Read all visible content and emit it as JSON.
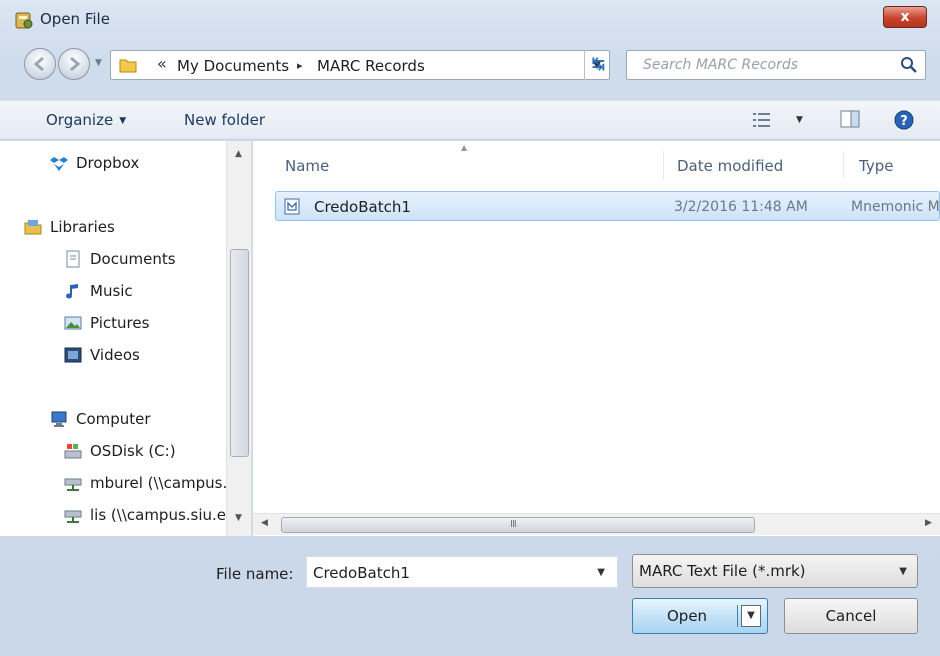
{
  "window": {
    "title": "Open File",
    "close_label": "x",
    "accent_color": "#c7442f"
  },
  "address_bar": {
    "overflow_chevron": "«",
    "breadcrumbs": [
      "My Documents",
      "MARC Records"
    ],
    "separator": "▸",
    "refresh_icon": "refresh-icon"
  },
  "search": {
    "placeholder": "Search MARC Records"
  },
  "toolbar": {
    "organize_label": "Organize",
    "new_folder_label": "New folder"
  },
  "navigation": {
    "items": [
      {
        "label": "Dropbox",
        "icon": "dropbox-icon"
      },
      {
        "label": "Libraries",
        "icon": "libraries-icon"
      },
      {
        "label": "Documents",
        "icon": "documents-icon"
      },
      {
        "label": "Music",
        "icon": "music-icon"
      },
      {
        "label": "Pictures",
        "icon": "pictures-icon"
      },
      {
        "label": "Videos",
        "icon": "videos-icon"
      },
      {
        "label": "Computer",
        "icon": "computer-icon"
      },
      {
        "label": "OSDisk (C:)",
        "icon": "drive-icon"
      },
      {
        "label": "mburel (\\\\campus.siu",
        "icon": "network-drive-icon"
      },
      {
        "label": "lis (\\\\campus.siu.edu",
        "icon": "network-drive-icon"
      }
    ]
  },
  "file_list": {
    "columns": [
      "Name",
      "Date modified",
      "Type"
    ],
    "rows": [
      {
        "name": "CredoBatch1",
        "date_modified": "3/2/2016 11:48 AM",
        "type": "Mnemonic MARC file",
        "selected": true
      }
    ],
    "scroll_grip": "III"
  },
  "footer": {
    "file_name_label": "File name:",
    "file_name_value": "CredoBatch1",
    "file_type_filter": "MARC Text File (*.mrk)",
    "open_label": "Open",
    "cancel_label": "Cancel"
  }
}
